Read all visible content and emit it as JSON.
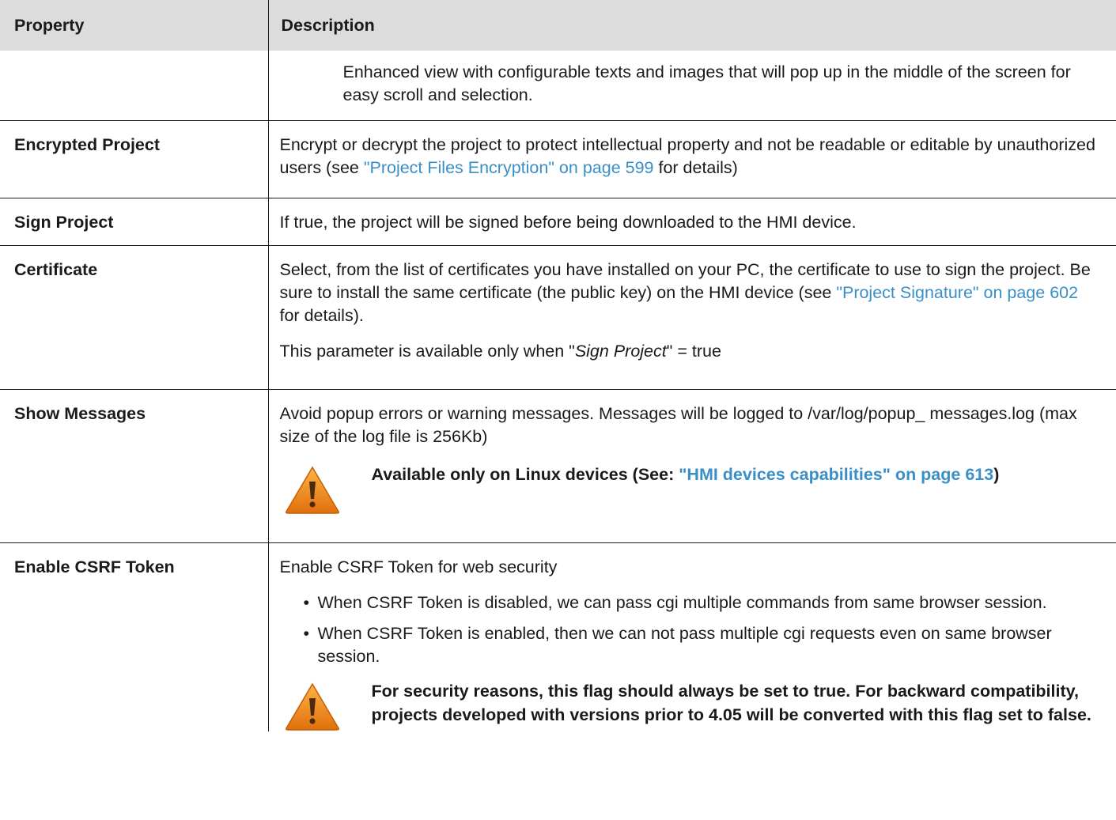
{
  "header": {
    "property": "Property",
    "description": "Description"
  },
  "rows": {
    "top": {
      "description": "Enhanced view with configurable texts and images that will pop up in the middle of the screen for easy scroll and selection."
    },
    "encrypted_project": {
      "property": "Encrypted Project",
      "desc_before": "Encrypt or decrypt the project to protect intellectual property and not be readable or editable by unauthorized users (see ",
      "link": "\"Project Files Encryption\" on page 599",
      "desc_after": " for details)"
    },
    "sign_project": {
      "property": "Sign Project",
      "description": "If true, the project will be signed before being downloaded to the HMI device."
    },
    "certificate": {
      "property": "Certificate",
      "desc_before": "Select, from the list of certificates you have installed on your PC, the certificate to use to sign the project. Be sure to install the same certificate (the public key) on the HMI device (see ",
      "link": "\"Project Signature\" on page 602",
      "desc_after": " for details).",
      "note_before": "This parameter is available only when \"",
      "note_italic": "Sign Project",
      "note_after": "\" = true"
    },
    "show_messages": {
      "property": "Show Messages",
      "description": "Avoid popup errors or warning messages. Messages will be logged to /var/log/popup_ messages.log (max size of the log file is 256Kb)",
      "warning_before": "Available only on Linux devices (See: ",
      "warning_link": "\"HMI devices capabilities\" on page 613",
      "warning_after": ")"
    },
    "enable_csrf": {
      "property": "Enable CSRF Token",
      "description": "Enable CSRF Token for web security",
      "bullets": [
        "When CSRF Token is disabled, we can pass cgi multiple commands from same browser session.",
        "When CSRF Token is enabled, then we can not pass multiple cgi requests even on same browser session."
      ],
      "warning": "For security reasons, this flag should always be set to true. For backward compatibility, projects developed with versions prior to 4.05 will be converted with this flag set to false."
    }
  },
  "colors": {
    "link": "#3a8fc7",
    "header_bg": "#dcdcdc",
    "warning_icon": "#f08a1c"
  },
  "icons": {
    "warning": "warning-triangle-icon"
  }
}
